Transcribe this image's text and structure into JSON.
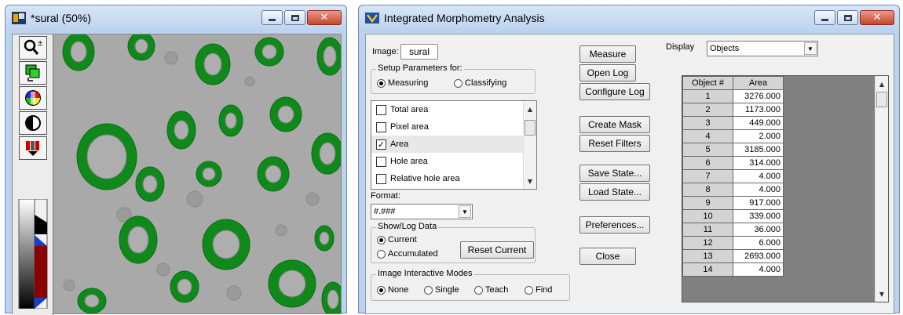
{
  "image_window": {
    "title": "*sural (50%)",
    "tools": [
      "zoom-tool-icon",
      "copy-layer-icon",
      "color-wheel-icon",
      "contrast-icon",
      "pseudocolor-icon"
    ]
  },
  "analysis_window": {
    "title": "Integrated Morphometry Analysis",
    "image_label": "Image:",
    "image_name": "sural",
    "setup": {
      "title": "Setup Parameters for:",
      "options": [
        "Measuring",
        "Classifying"
      ],
      "selected": "Measuring"
    },
    "parameters": [
      {
        "label": "Total area",
        "checked": false
      },
      {
        "label": "Pixel area",
        "checked": false
      },
      {
        "label": "Area",
        "checked": true
      },
      {
        "label": "Hole area",
        "checked": false
      },
      {
        "label": "Relative hole area",
        "checked": false
      }
    ],
    "format_label": "Format:",
    "format_value": "#.###",
    "show_log": {
      "title": "Show/Log Data",
      "options": [
        "Current",
        "Accumulated"
      ],
      "selected": "Current",
      "reset_label": "Reset Current"
    },
    "modes": {
      "title": "Image Interactive Modes",
      "options": [
        "None",
        "Single",
        "Teach",
        "Find"
      ],
      "selected": "None"
    },
    "buttons": {
      "measure": "Measure",
      "open_log": "Open Log",
      "configure_log": "Configure Log",
      "create_mask": "Create Mask",
      "reset_filters": "Reset Filters",
      "save_state": "Save State...",
      "load_state": "Load State...",
      "preferences": "Preferences...",
      "close": "Close"
    },
    "display_label": "Display",
    "display_value": "Objects",
    "table": {
      "headers": [
        "Object #",
        "Area"
      ],
      "rows": [
        [
          "1",
          "3276.000"
        ],
        [
          "2",
          "1173.000"
        ],
        [
          "3",
          "449.000"
        ],
        [
          "4",
          "2.000"
        ],
        [
          "5",
          "3185.000"
        ],
        [
          "6",
          "314.000"
        ],
        [
          "7",
          "4.000"
        ],
        [
          "8",
          "4.000"
        ],
        [
          "9",
          "917.000"
        ],
        [
          "10",
          "339.000"
        ],
        [
          "11",
          "36.000"
        ],
        [
          "12",
          "6.000"
        ],
        [
          "13",
          "2693.000"
        ],
        [
          "14",
          "4.000"
        ]
      ]
    }
  },
  "colors": {
    "segment_green": "#0f8a1a",
    "title_bar": "#bcd3ee",
    "close_red": "#c5462d"
  }
}
